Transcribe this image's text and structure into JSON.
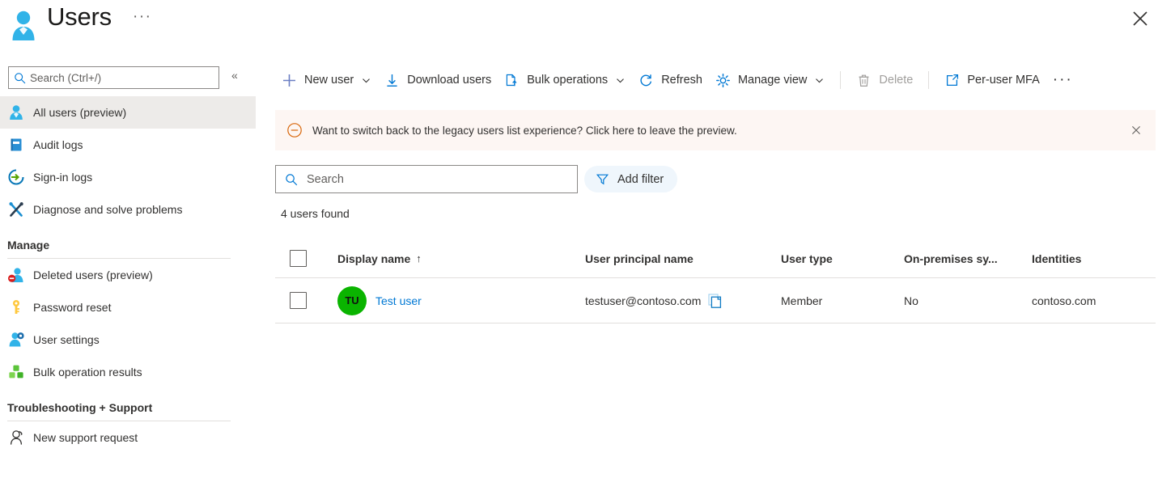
{
  "header": {
    "title": "Users",
    "ellipsis": "···",
    "icon": "user-avatar-icon",
    "close_icon": "close-icon"
  },
  "sidebar": {
    "search": {
      "placeholder": "Search (Ctrl+/)",
      "value": "",
      "icon": "search-icon"
    },
    "collapse_icon": "chevron-double-left-icon",
    "nav_items": [
      {
        "label": "All users (preview)",
        "icon": "user-icon",
        "active": true
      },
      {
        "label": "Audit logs",
        "icon": "book-icon",
        "active": false
      },
      {
        "label": "Sign-in logs",
        "icon": "sign-in-icon",
        "active": false
      },
      {
        "label": "Diagnose and solve problems",
        "icon": "wrench-screwdriver-icon",
        "active": false
      }
    ],
    "sections": [
      {
        "title": "Manage",
        "items": [
          {
            "label": "Deleted users (preview)",
            "icon": "user-deleted-icon"
          },
          {
            "label": "Password reset",
            "icon": "key-icon"
          },
          {
            "label": "User settings",
            "icon": "user-gear-icon"
          },
          {
            "label": "Bulk operation results",
            "icon": "bulk-cubes-icon"
          }
        ]
      },
      {
        "title": "Troubleshooting + Support",
        "items": [
          {
            "label": "New support request",
            "icon": "support-person-icon"
          }
        ]
      }
    ]
  },
  "toolbar": {
    "new_user": "New user",
    "download_users": "Download users",
    "bulk_operations": "Bulk operations",
    "refresh": "Refresh",
    "manage_view": "Manage view",
    "delete": "Delete",
    "per_user_mfa": "Per-user MFA",
    "overflow": "···"
  },
  "banner": {
    "text": "Want to switch back to the legacy users list experience? Click here to leave the preview.",
    "icon": "minus-circle-icon",
    "close_icon": "close-icon",
    "background": "#fdf6f3",
    "accent": "#d8660a"
  },
  "filters": {
    "search": {
      "placeholder": "Search",
      "value": "",
      "icon": "search-icon"
    },
    "add_filter": "Add filter",
    "filter_icon": "funnel-icon"
  },
  "results": {
    "count_text": "4 users found"
  },
  "table": {
    "columns": [
      {
        "label": "Display name",
        "sort": "↑"
      },
      {
        "label": "User principal name"
      },
      {
        "label": "User type"
      },
      {
        "label": "On-premises sy..."
      },
      {
        "label": "Identities"
      }
    ],
    "rows": [
      {
        "initials": "TU",
        "avatar_color": "#0ab400",
        "display_name": "Test user",
        "user_principal_name": "testuser@contoso.com",
        "user_type": "Member",
        "on_premises_sync": "No",
        "identities": "contoso.com",
        "copy_icon": "copy-icon"
      }
    ]
  },
  "colors": {
    "accent": "#0078d4",
    "selected_row": "#edebe9",
    "divider": "#e1dfdd"
  }
}
